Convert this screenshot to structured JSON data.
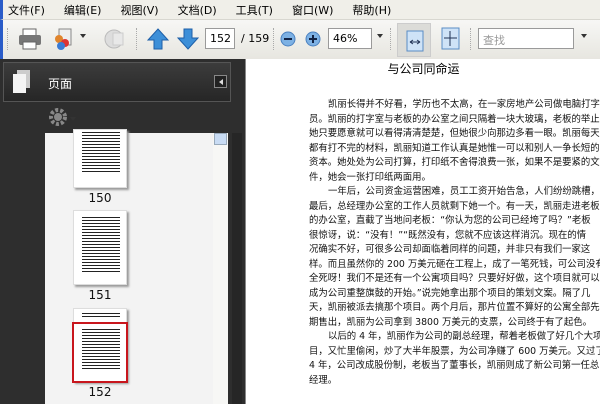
{
  "menu": [
    "文件(F)",
    "编辑(E)",
    "视图(V)",
    "文档(D)",
    "工具(T)",
    "窗口(W)",
    "帮助(H)"
  ],
  "toolbar": {
    "page_current": "152",
    "page_total": "/ 159",
    "zoom": "46%",
    "search_placeholder": "查找"
  },
  "panel": {
    "title": "页面",
    "thumbnails": [
      {
        "label": "150"
      },
      {
        "label": "151"
      },
      {
        "label": "152",
        "selected": true
      }
    ]
  },
  "document": {
    "title": "与公司同命运",
    "lines": [
      "凯丽长得并不好看，学历也不太高，在一家房地产公司做电脑打字",
      "员。凯丽的打字室与老板的办公室之间只隔着一块大玻璃，老板的举止",
      "她只要愿意就可以看得清清楚楚，但她很少向那边多看一眼。凯丽每天",
      "都有打不完的材料，凯丽知道工作认真是她惟一可以和别人一争长短的",
      "资本。她处处为公司打算，打印纸不舍得浪费一张，如果不是要紧的文",
      "件，她会一张打印纸两面用。",
      "一年后，公司资金运营困难，员工工资开始告急，人们纷纷跳槽，",
      "最后，总经理办公室的工作人员就剩下她一个。有一天，凯丽走进老板",
      "的办公室，直截了当地问老板：“你认为您的公司已经垮了吗？”老板",
      "很惊讶，说：“没有！”“既然没有，您就不应该这样消沉。现在的情",
      "况确实不好，可很多公司却面临着同样的问题，并非只有我们一家这",
      "样。而且虽然你的 200 万美元砸在工程上，成了一笔死钱，可公司没有",
      "全死呀！我们不是还有一个公寓项目吗？只要好好做，这个项目就可以",
      "成为公司重整旗鼓的开始。”说完她拿出那个项目的策划文案。隔了几",
      "天，凯丽被派去搞那个项目。两个月后，那片位置不算好的公寓全部先",
      "期售出，凯丽为公司拿到 3800 万美元的支票，公司终于有了起色。",
      "以后的 4 年，凯丽作为公司的副总经理，帮着老板做了好几个大项",
      "目，又忙里偷闲，炒了大半年股票，为公司净赚了 600 万美元。又过了",
      "4 年，公司改成股份制，老板当了董事长，凯丽则成了新公司第一任总",
      "经理。"
    ]
  }
}
